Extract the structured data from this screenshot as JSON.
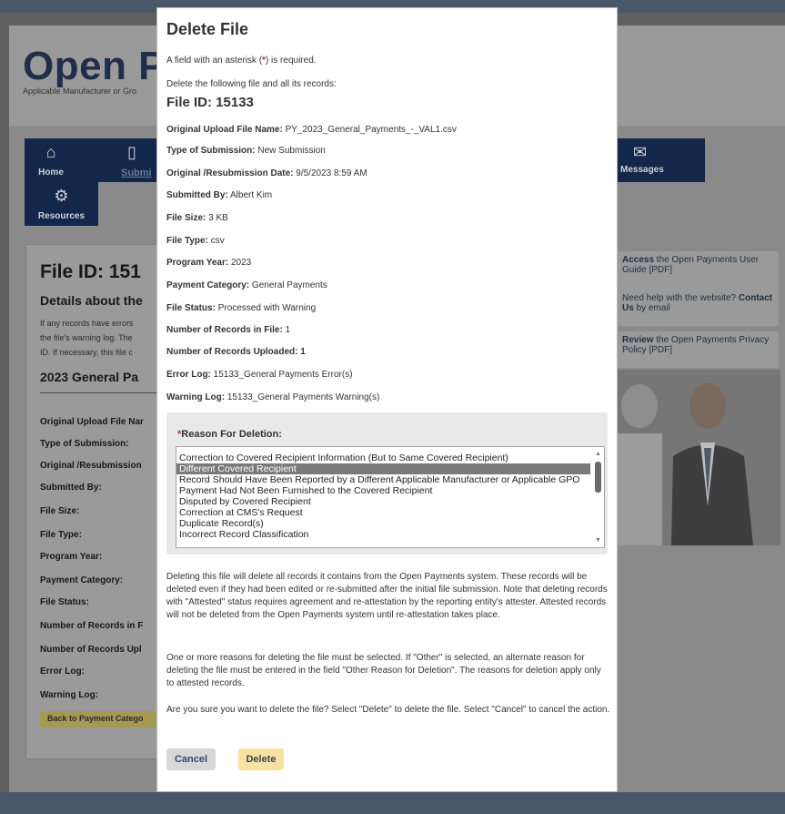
{
  "background": {
    "logo": "Open Pa",
    "tagline": "Applicable Manufacturer or Gro",
    "nav": [
      {
        "label": "Home",
        "icon": "home-icon"
      },
      {
        "label": "Submi",
        "icon": "upload-icon"
      },
      {
        "label": "Messages",
        "icon": "mail-icon"
      },
      {
        "label": "Resources",
        "icon": "gear-icon"
      }
    ],
    "page_title": "File ID: 151",
    "details_heading": "Details about the",
    "notes": [
      "If any records have errors",
      "the file's warning log. The",
      "ID. If necessary, this file c"
    ],
    "section_heading": "2023 General Pa",
    "fields": [
      "Original Upload File Nar",
      "Type of Submission:",
      "Original /Resubmission",
      "Submitted By:",
      "File Size:",
      "File Type:",
      "Program Year:",
      "Payment Category:",
      "File Status:",
      "Number of Records in F",
      "Number of Records Upl",
      "Error Log:",
      "Warning Log:"
    ],
    "back_button": "Back to Payment Catego",
    "side_links": [
      {
        "bold": "Access",
        "text": " the Open Payments User Guide [PDF]"
      },
      {
        "bold": "",
        "text": "Need help with the website? ",
        "bold2": "Contact Us",
        "text2": " by email"
      },
      {
        "bold": "Review",
        "text": " the Open Payments Privacy Policy [PDF]"
      }
    ]
  },
  "modal": {
    "title": "Delete File",
    "required_note_pre": "A field with an asterisk (",
    "required_star": "*",
    "required_note_post": ") is required.",
    "delete_note": "Delete the following file and all its records:",
    "file_id": "File ID: 15133",
    "info": [
      {
        "label": "Original Upload File Name:",
        "value": "PY_2023_General_Payments_-_VAL1.csv"
      },
      {
        "label": "Type of Submission:",
        "value": "New Submission"
      },
      {
        "label": "Original /Resubmission Date:",
        "value": "9/5/2023 8:59 AM"
      },
      {
        "label": "Submitted By:",
        "value": "Albert Kim"
      },
      {
        "label": "File Size:",
        "value": "3 KB"
      },
      {
        "label": "File Type:",
        "value": "csv"
      },
      {
        "label": "Program Year:",
        "value": "2023"
      },
      {
        "label": "Payment Category:",
        "value": "General Payments"
      },
      {
        "label": "File Status:",
        "value": "Processed with Warning"
      },
      {
        "label": "Number of Records in File:",
        "value": "1"
      },
      {
        "label": "Number of Records Uploaded:",
        "value": "1"
      },
      {
        "label": "Error Log:",
        "value": "15133_General Payments Error(s)"
      },
      {
        "label": "Warning Log:",
        "value": "15133_General Payments Warning(s)"
      }
    ],
    "reason_label": "Reason For Deletion:",
    "reason_star": "*",
    "reasons": [
      "Correction to Covered Recipient Information (But to Same Covered Recipient)",
      "Different Covered Recipient",
      "Record Should Have Been Reported by a Different Applicable Manufacturer or Applicable GPO",
      "Payment Had Not Been Furnished to the Covered Recipient",
      "Disputed by Covered Recipient",
      "Correction at CMS's Request",
      "Duplicate Record(s)",
      "Incorrect Record Classification"
    ],
    "selected_reason_index": 1,
    "para1": "Deleting this file will delete all records it contains from the Open Payments system. These records will be deleted even if they had been edited or re-submitted after the initial file submission. Note that deleting records with \"Attested\" status requires agreement and re-attestation by the reporting entity's attester. Attested records will not be deleted from the Open Payments system until re-attestation takes place.",
    "para2": "One or more reasons for deleting the file must be selected. If \"Other\" is selected, an alternate reason for deleting the file must be entered in the field \"Other Reason for Deletion\". The reasons for deletion apply only to attested records.",
    "para3": "Are you sure you want to delete the file? Select \"Delete\" to delete the file. Select \"Cancel\" to cancel the action.",
    "cancel_label": "Cancel",
    "delete_label": "Delete"
  }
}
